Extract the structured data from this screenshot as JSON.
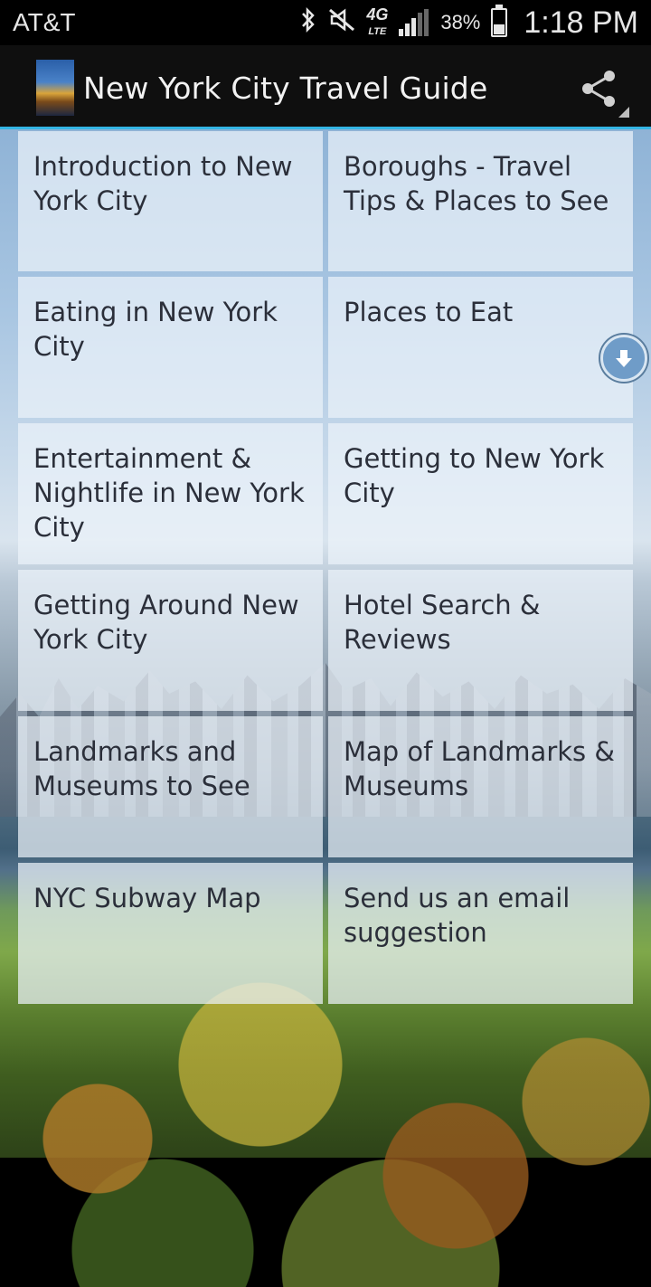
{
  "status_bar": {
    "carrier": "AT&T",
    "battery_percent": "38%",
    "battery_level": 0.38,
    "time": "1:18 PM",
    "network": "4G",
    "network_sub": "LTE",
    "icons": [
      "bluetooth-icon",
      "mute-icon",
      "4g-lte-icon",
      "signal-icon",
      "battery-icon"
    ]
  },
  "action_bar": {
    "title": "New York City Travel Guide",
    "icons": [
      "app-logo-icon",
      "share-icon"
    ]
  },
  "menu": {
    "items": [
      {
        "label": "Introduction to New York City"
      },
      {
        "label": "Boroughs - Travel Tips & Places to See"
      },
      {
        "label": "Eating in New York City"
      },
      {
        "label": "Places to Eat"
      },
      {
        "label": "Entertainment & Nightlife in New York City"
      },
      {
        "label": "Getting to New York City"
      },
      {
        "label": "Getting Around New York City"
      },
      {
        "label": "Hotel Search & Reviews"
      },
      {
        "label": "Landmarks and Museums to See"
      },
      {
        "label": "Map of Landmarks & Museums"
      },
      {
        "label": "NYC Subway Map"
      },
      {
        "label": "Send us an email suggestion"
      }
    ]
  },
  "floating": {
    "icon": "download-arrow-icon"
  }
}
